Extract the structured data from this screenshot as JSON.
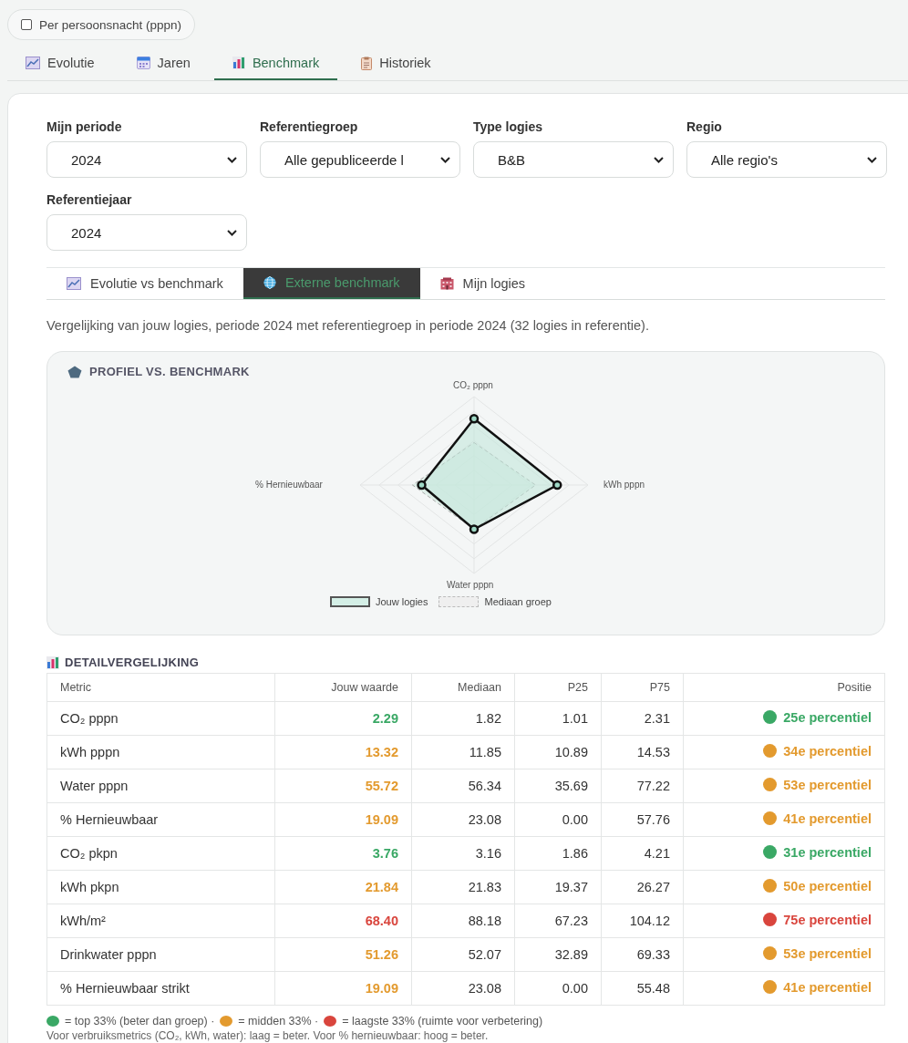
{
  "per_night": {
    "label": "Per persoonsnacht (pppn)",
    "checked": false
  },
  "tabs": [
    {
      "label": "Evolutie",
      "selected": false
    },
    {
      "label": "Jaren",
      "selected": false
    },
    {
      "label": "Benchmark",
      "selected": true
    },
    {
      "label": "Historiek",
      "selected": false
    }
  ],
  "filters": [
    {
      "label": "Mijn periode",
      "value": "2024"
    },
    {
      "label": "Referentiegroep",
      "value": "Alle gepubliceerde l"
    },
    {
      "label": "Type logies",
      "value": "B&B"
    },
    {
      "label": "Regio",
      "value": "Alle regio's"
    },
    {
      "label": "Referentiejaar",
      "value": "2024"
    }
  ],
  "subtabs": [
    {
      "label": "Evolutie vs benchmark",
      "selected": false
    },
    {
      "label": "Externe benchmark",
      "selected": true
    },
    {
      "label": "Mijn logies",
      "selected": false
    }
  ],
  "description": "Vergelijking van jouw logies, periode 2024 met referentiegroep in periode 2024 (32 logies in referentie).",
  "radar": {
    "title": "PROFIEL VS. BENCHMARK",
    "axes": [
      "CO₂ pppn",
      "kWh pppn",
      "Water pppn",
      "% Hernieuwbaar"
    ],
    "legend": [
      "Jouw logies",
      "Mediaan groep"
    ]
  },
  "detail": {
    "title": "DETAILVERGELIJKING",
    "columns": [
      "Metric",
      "Jouw waarde",
      "Mediaan",
      "P25",
      "P75",
      "Positie"
    ],
    "rows": [
      {
        "metric": "CO₂ pppn",
        "value": "2.29",
        "median": "1.82",
        "p25": "1.01",
        "p75": "2.31",
        "position": "25e percentiel",
        "color": "#3aa865"
      },
      {
        "metric": "kWh pppn",
        "value": "13.32",
        "median": "11.85",
        "p25": "10.89",
        "p75": "14.53",
        "position": "34e percentiel",
        "color": "#e39a2e"
      },
      {
        "metric": "Water pppn",
        "value": "55.72",
        "median": "56.34",
        "p25": "35.69",
        "p75": "77.22",
        "position": "53e percentiel",
        "color": "#e39a2e"
      },
      {
        "metric": "% Hernieuwbaar",
        "value": "19.09",
        "median": "23.08",
        "p25": "0.00",
        "p75": "57.76",
        "position": "41e percentiel",
        "color": "#e39a2e"
      },
      {
        "metric": "CO₂ pkpn",
        "value": "3.76",
        "median": "3.16",
        "p25": "1.86",
        "p75": "4.21",
        "position": "31e percentiel",
        "color": "#3aa865"
      },
      {
        "metric": "kWh pkpn",
        "value": "21.84",
        "median": "21.83",
        "p25": "19.37",
        "p75": "26.27",
        "position": "50e percentiel",
        "color": "#e39a2e"
      },
      {
        "metric": "kWh/m²",
        "value": "68.40",
        "median": "88.18",
        "p25": "67.23",
        "p75": "104.12",
        "position": "75e percentiel",
        "color": "#d9453d"
      },
      {
        "metric": "Drinkwater pppn",
        "value": "51.26",
        "median": "52.07",
        "p25": "32.89",
        "p75": "69.33",
        "position": "53e percentiel",
        "color": "#e39a2e"
      },
      {
        "metric": "% Hernieuwbaar strikt",
        "value": "19.09",
        "median": "23.08",
        "p25": "0.00",
        "p75": "55.48",
        "position": "41e percentiel",
        "color": "#e39a2e"
      }
    ]
  },
  "legend": [
    {
      "color": "#3aa865",
      "text": "= top 33% (beter dan groep) ·"
    },
    {
      "color": "#e39a2e",
      "text": "= midden 33% ·"
    },
    {
      "color": "#d9453d",
      "text": "= laagste 33% (ruimte voor verbetering)"
    }
  ],
  "note": "Voor verbruiksmetrics (CO₂, kWh, water): laag = beter. Voor % hernieuwbaar: hoog = beter."
}
